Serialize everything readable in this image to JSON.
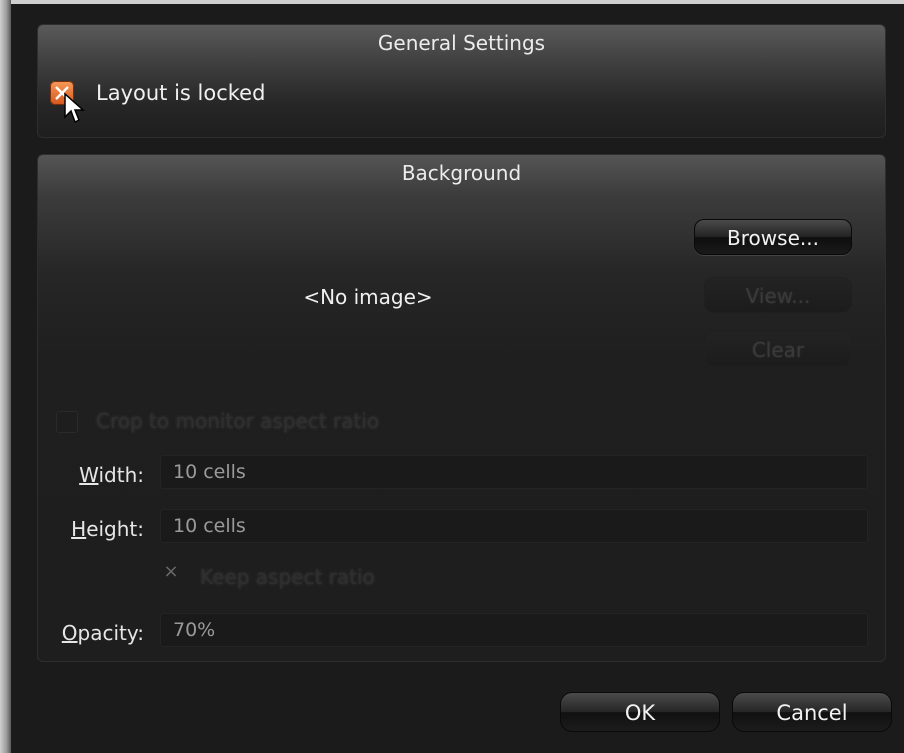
{
  "general_settings": {
    "title": "General Settings",
    "layout_locked": {
      "label": "Layout is locked",
      "checked": true
    }
  },
  "background": {
    "title": "Background",
    "image_placeholder": "<No image>",
    "buttons": {
      "browse": "Browse...",
      "view": "View...",
      "clear": "Clear"
    },
    "crop_checkbox": {
      "label": "Crop to monitor aspect ratio",
      "checked": false
    },
    "width": {
      "label_underlined": "W",
      "label_rest": "idth:",
      "value": "10 cells"
    },
    "height": {
      "label_underlined": "H",
      "label_rest": "eight:",
      "value": "10 cells"
    },
    "keep_aspect": {
      "label": "Keep aspect ratio",
      "mark": "×"
    },
    "opacity": {
      "label_underlined": "O",
      "label_rest": "pacity:",
      "value": "70%"
    }
  },
  "footer": {
    "ok": "OK",
    "cancel": "Cancel"
  },
  "colors": {
    "accent_orange": "#e4722e",
    "panel_bg": "#1e1e1e"
  },
  "icons": {
    "check_mark": "x-mark-icon",
    "cursor": "mouse-cursor-icon"
  }
}
